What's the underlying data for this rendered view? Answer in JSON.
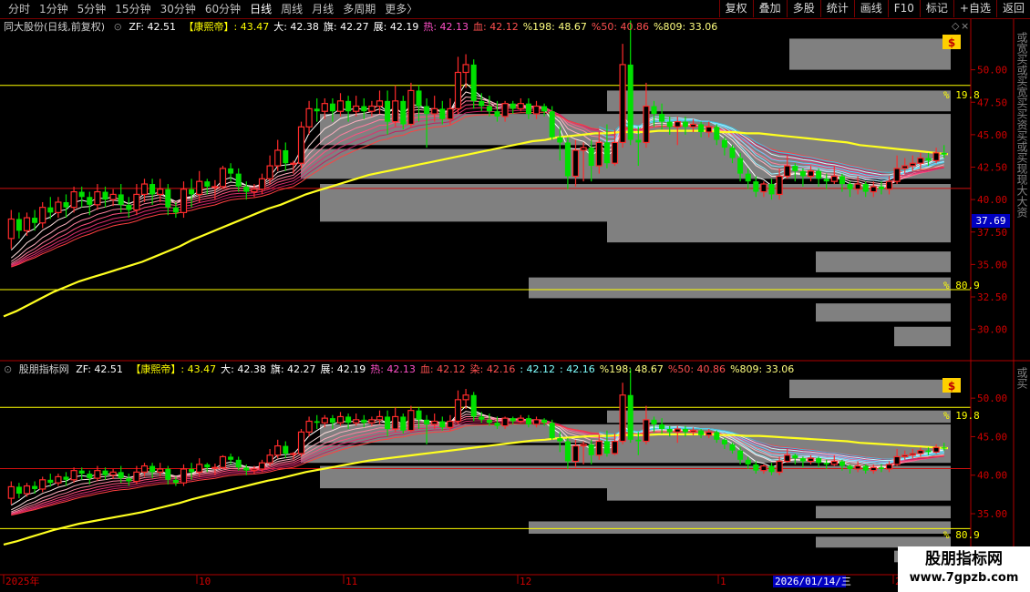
{
  "toolbar": {
    "periods": [
      "分时",
      "1分钟",
      "5分钟",
      "15分钟",
      "30分钟",
      "60分钟",
      "日线",
      "周线",
      "月线",
      "多周期",
      "更多〉"
    ],
    "active_period": "日线",
    "actions": [
      "复权",
      "叠加",
      "多股",
      "统计",
      "画线",
      "F10",
      "标记",
      "+自选",
      "返回"
    ]
  },
  "colors": {
    "up": "#ff2b2b",
    "down": "#00e000",
    "ma": "#ffff20",
    "box": "#808080",
    "line": "#ffff00",
    "redline": "#d01010",
    "axis": "#b00000"
  },
  "top_panel": {
    "title": "同大股份(日线,前复权)",
    "zf_label": "ZF: 42.51",
    "legend": [
      {
        "text": "【康熙帝】: 43.47",
        "color": "#ffff00"
      },
      {
        "text": "大: 42.38",
        "color": "#ffffff"
      },
      {
        "text": "旗: 42.27",
        "color": "#ffffff"
      },
      {
        "text": "展: 42.19",
        "color": "#ffffff"
      },
      {
        "text": "热: 42.13",
        "color": "#ff50c8"
      },
      {
        "text": "血: 42.12",
        "color": "#ff5050"
      },
      {
        "text": "%198: 48.67",
        "color": "#ffff80"
      },
      {
        "text": "%50: 40.86",
        "color": "#ff5050"
      },
      {
        "text": "%809: 33.06",
        "color": "#ffff80"
      }
    ],
    "price_ticks": [
      "50.00",
      "47.50",
      "45.00",
      "42.50",
      "40.00",
      "37.50",
      "35.00",
      "32.50",
      "30.00"
    ],
    "last_price": "37.69",
    "hline_labels": [
      "% 19.8",
      "% 80.9"
    ],
    "side_text": "或宽买或买宽买买资买或买现现大大资"
  },
  "bottom_panel": {
    "title": "股朋指标网",
    "zf_label": "ZF: 42.51",
    "legend": [
      {
        "text": "【康熙帝】: 43.47",
        "color": "#ffff00"
      },
      {
        "text": "大: 42.38",
        "color": "#ffffff"
      },
      {
        "text": "旗: 42.27",
        "color": "#ffffff"
      },
      {
        "text": "展: 42.19",
        "color": "#ffffff"
      },
      {
        "text": "热: 42.13",
        "color": "#ff50c8"
      },
      {
        "text": "血: 42.12",
        "color": "#ff5050"
      },
      {
        "text": "染: 42.16",
        "color": "#ff5050"
      },
      {
        "text": ": 42.12",
        "color": "#80ffff"
      },
      {
        "text": ": 42.16",
        "color": "#80ffff"
      },
      {
        "text": "%198: 48.67",
        "color": "#ffff80"
      },
      {
        "text": "%50: 40.86",
        "color": "#ff5050"
      },
      {
        "text": "%809: 33.06",
        "color": "#ffff80"
      }
    ],
    "price_ticks": [
      "50.00",
      "45.00",
      "40.00",
      "35.00"
    ],
    "hline_labels": [
      "% 19.8",
      "% 80.9"
    ],
    "side_text": "或买"
  },
  "date_axis": {
    "labels": [
      "2025年",
      "10",
      "11",
      "12",
      "1",
      "2"
    ],
    "cursor_date": "2026/01/14/三"
  },
  "watermark": {
    "line1": "股朋指标网",
    "line2": "www.7gpzb.com"
  },
  "chart_data": {
    "type": "candlestick",
    "ylim": [
      28.5,
      52.5
    ],
    "hlines": [
      48.8,
      40.86,
      33.06
    ],
    "last_price": 37.69,
    "ma": [
      31.0,
      31.4,
      31.9,
      32.4,
      32.9,
      33.3,
      33.7,
      34.0,
      34.3,
      34.6,
      34.9,
      35.2,
      35.6,
      36.0,
      36.4,
      36.9,
      37.3,
      37.7,
      38.1,
      38.5,
      38.9,
      39.3,
      39.6,
      40.0,
      40.4,
      40.7,
      41.0,
      41.3,
      41.6,
      41.9,
      42.1,
      42.3,
      42.5,
      42.7,
      42.9,
      43.1,
      43.3,
      43.5,
      43.7,
      43.9,
      44.1,
      44.3,
      44.5,
      44.6,
      44.8,
      44.9,
      45.0,
      45.1,
      45.1,
      45.2,
      45.2,
      45.2,
      45.3,
      45.3,
      45.3,
      45.3,
      45.3,
      45.2,
      45.2,
      45.1,
      45.1,
      45.0,
      44.9,
      44.8,
      44.7,
      44.6,
      44.5,
      44.4,
      44.2,
      44.1,
      44.0,
      43.9,
      43.8,
      43.7,
      43.6,
      43.5
    ],
    "candles": [
      [
        37.0,
        38.5,
        36.2,
        39.2
      ],
      [
        38.5,
        37.6,
        37.0,
        39.0
      ],
      [
        37.6,
        38.6,
        37.2,
        39.0
      ],
      [
        38.6,
        38.2,
        37.6,
        39.2
      ],
      [
        38.2,
        39.4,
        37.8,
        39.8
      ],
      [
        39.4,
        39.0,
        38.5,
        40.2
      ],
      [
        39.0,
        39.8,
        38.6,
        40.2
      ],
      [
        39.8,
        39.4,
        38.6,
        40.4
      ],
      [
        39.4,
        40.6,
        39.0,
        41.0
      ],
      [
        40.6,
        40.2,
        39.4,
        41.0
      ],
      [
        40.2,
        39.6,
        38.8,
        40.6
      ],
      [
        39.6,
        40.6,
        39.2,
        41.2
      ],
      [
        40.6,
        40.0,
        39.4,
        41.0
      ],
      [
        40.0,
        40.4,
        39.5,
        40.8
      ],
      [
        40.4,
        39.6,
        39.0,
        41.2
      ],
      [
        39.6,
        39.2,
        38.6,
        40.2
      ],
      [
        39.2,
        40.4,
        38.8,
        41.2
      ],
      [
        40.4,
        41.2,
        39.8,
        41.6
      ],
      [
        41.2,
        40.4,
        39.6,
        41.6
      ],
      [
        40.4,
        40.8,
        39.8,
        41.6
      ],
      [
        40.8,
        39.4,
        38.8,
        41.2
      ],
      [
        39.4,
        39.0,
        38.6,
        39.8
      ],
      [
        39.0,
        40.8,
        38.6,
        41.4
      ],
      [
        40.8,
        40.4,
        39.4,
        41.6
      ],
      [
        40.4,
        41.4,
        39.8,
        42.2
      ],
      [
        41.4,
        41.0,
        40.4,
        41.6
      ],
      [
        41.0,
        41.0,
        40.0,
        41.5
      ],
      [
        41.0,
        42.4,
        40.8,
        42.6
      ],
      [
        42.4,
        42.0,
        41.4,
        42.8
      ],
      [
        42.0,
        41.0,
        40.6,
        42.4
      ],
      [
        41.0,
        40.6,
        40.0,
        41.4
      ],
      [
        40.6,
        40.8,
        40.2,
        41.2
      ],
      [
        40.8,
        41.6,
        40.4,
        42.0
      ],
      [
        41.6,
        42.6,
        41.2,
        43.4
      ],
      [
        42.6,
        43.8,
        42.2,
        44.6
      ],
      [
        43.8,
        42.8,
        42.2,
        44.4
      ],
      [
        42.8,
        42.8,
        42.0,
        43.0
      ],
      [
        42.8,
        45.6,
        42.4,
        46.0
      ],
      [
        45.6,
        47.0,
        45.0,
        47.6
      ],
      [
        47.0,
        46.8,
        46.0,
        47.8
      ],
      [
        46.8,
        47.4,
        46.2,
        47.8
      ],
      [
        47.4,
        46.8,
        46.0,
        47.8
      ],
      [
        46.8,
        47.6,
        46.4,
        48.2
      ],
      [
        47.6,
        46.8,
        46.0,
        48.0
      ],
      [
        46.8,
        47.2,
        46.4,
        48.0
      ],
      [
        47.2,
        46.8,
        46.2,
        47.8
      ],
      [
        46.8,
        47.2,
        46.4,
        47.6
      ],
      [
        47.2,
        47.6,
        46.6,
        48.4
      ],
      [
        47.6,
        46.0,
        45.0,
        48.4
      ],
      [
        46.0,
        47.6,
        45.6,
        48.8
      ],
      [
        47.6,
        45.8,
        45.4,
        48.0
      ],
      [
        45.8,
        48.4,
        45.6,
        49.0
      ],
      [
        48.4,
        47.2,
        46.0,
        48.8
      ],
      [
        47.2,
        46.6,
        44.0,
        47.8
      ],
      [
        46.6,
        47.0,
        46.0,
        48.0
      ],
      [
        47.0,
        46.2,
        45.8,
        47.6
      ],
      [
        46.2,
        47.0,
        45.8,
        47.8
      ],
      [
        47.0,
        49.8,
        46.6,
        51.0
      ],
      [
        49.8,
        50.4,
        48.6,
        51.2
      ],
      [
        50.4,
        47.6,
        47.0,
        50.8
      ],
      [
        47.6,
        47.2,
        46.8,
        48.2
      ],
      [
        47.2,
        46.8,
        46.4,
        48.0
      ],
      [
        46.8,
        46.4,
        46.0,
        47.6
      ],
      [
        46.4,
        47.4,
        46.0,
        47.6
      ],
      [
        47.4,
        47.0,
        46.6,
        47.6
      ],
      [
        47.0,
        47.4,
        46.8,
        47.8
      ],
      [
        47.4,
        46.6,
        46.2,
        47.8
      ],
      [
        46.6,
        47.2,
        46.2,
        47.6
      ],
      [
        47.2,
        46.8,
        46.4,
        47.4
      ],
      [
        46.8,
        44.8,
        44.6,
        47.2
      ],
      [
        44.8,
        44.4,
        43.0,
        45.6
      ],
      [
        44.4,
        41.8,
        40.8,
        44.8
      ],
      [
        41.8,
        43.8,
        41.0,
        44.6
      ],
      [
        43.8,
        44.0,
        41.4,
        44.4
      ],
      [
        44.0,
        42.6,
        41.4,
        44.6
      ],
      [
        42.6,
        44.4,
        42.0,
        45.2
      ],
      [
        44.4,
        42.8,
        42.4,
        45.8
      ],
      [
        42.8,
        44.4,
        42.6,
        45.4
      ],
      [
        44.4,
        50.4,
        44.0,
        52.0
      ],
      [
        50.4,
        44.6,
        44.2,
        53.8
      ],
      [
        44.6,
        44.4,
        42.6,
        45.6
      ],
      [
        44.4,
        47.2,
        44.0,
        49.0
      ],
      [
        47.2,
        46.6,
        45.6,
        47.6
      ],
      [
        46.6,
        46.0,
        45.4,
        47.4
      ],
      [
        46.0,
        45.6,
        45.0,
        46.4
      ],
      [
        45.6,
        46.0,
        44.2,
        46.4
      ],
      [
        46.0,
        45.6,
        45.0,
        46.4
      ],
      [
        45.6,
        45.8,
        45.2,
        46.2
      ],
      [
        45.8,
        45.2,
        44.8,
        46.0
      ],
      [
        45.2,
        45.6,
        44.8,
        46.0
      ],
      [
        45.6,
        44.6,
        44.2,
        45.8
      ],
      [
        44.6,
        44.0,
        43.4,
        44.8
      ],
      [
        44.0,
        43.2,
        42.8,
        44.2
      ],
      [
        43.2,
        42.0,
        41.4,
        43.6
      ],
      [
        42.0,
        41.4,
        40.8,
        42.4
      ],
      [
        41.4,
        40.6,
        40.2,
        41.8
      ],
      [
        40.6,
        41.2,
        40.2,
        41.4
      ],
      [
        41.2,
        40.4,
        40.0,
        41.6
      ],
      [
        40.4,
        41.8,
        40.0,
        42.4
      ],
      [
        41.8,
        42.6,
        41.6,
        43.4
      ],
      [
        42.6,
        42.2,
        41.4,
        42.8
      ],
      [
        42.2,
        41.8,
        41.0,
        42.4
      ],
      [
        41.8,
        42.2,
        41.4,
        42.6
      ],
      [
        42.2,
        41.6,
        41.0,
        42.4
      ],
      [
        41.6,
        41.4,
        40.8,
        42.0
      ],
      [
        41.4,
        41.8,
        41.2,
        42.6
      ],
      [
        41.8,
        41.2,
        40.6,
        42.0
      ],
      [
        41.2,
        40.8,
        40.2,
        41.4
      ],
      [
        40.8,
        41.2,
        40.4,
        41.8
      ],
      [
        41.2,
        40.6,
        40.2,
        41.4
      ],
      [
        40.6,
        41.0,
        40.2,
        41.4
      ],
      [
        41.0,
        40.8,
        40.4,
        41.4
      ],
      [
        40.8,
        41.4,
        40.4,
        41.8
      ],
      [
        41.4,
        42.4,
        41.2,
        43.4
      ],
      [
        42.4,
        42.6,
        42.0,
        43.2
      ],
      [
        42.6,
        42.8,
        42.2,
        43.4
      ],
      [
        42.8,
        43.2,
        42.4,
        43.6
      ],
      [
        43.2,
        43.0,
        42.6,
        43.6
      ],
      [
        43.0,
        43.6,
        42.8,
        44.0
      ],
      [
        43.6,
        43.47,
        43.2,
        44.2
      ]
    ],
    "boxes": [
      [
        351,
        1000,
        46.6,
        44.2
      ],
      [
        330,
        1000,
        43.9,
        41.6
      ],
      [
        351,
        1000,
        41.2,
        38.3
      ],
      [
        866,
        1000,
        52.4,
        50.0
      ],
      [
        666,
        1000,
        48.4,
        46.8
      ],
      [
        666,
        1000,
        45.8,
        43.6
      ],
      [
        666,
        1000,
        40.9,
        38.3
      ],
      [
        666,
        1000,
        38.6,
        36.7
      ],
      [
        895,
        1000,
        36.0,
        34.4
      ],
      [
        580,
        1000,
        34.0,
        32.4
      ],
      [
        895,
        1000,
        32.0,
        30.6
      ],
      [
        981,
        1000,
        30.2,
        28.7
      ]
    ]
  }
}
